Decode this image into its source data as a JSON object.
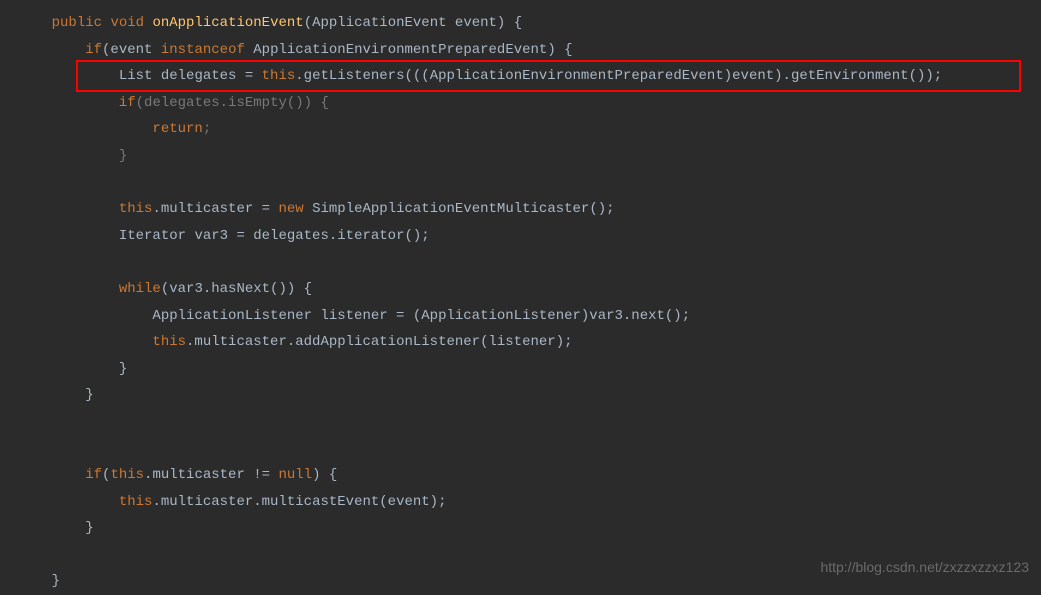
{
  "code": {
    "line1_public": "public",
    "line1_void": "void",
    "line1_method": "onApplicationEvent",
    "line1_rest": "(ApplicationEvent event) {",
    "line2_if": "if",
    "line2_event": "(event",
    "line2_instanceof": "instanceof",
    "line2_rest": "ApplicationEnvironmentPreparedEvent) {",
    "line3_list": "List delegates = ",
    "line3_this": "this",
    "line3_rest": ".getListeners(((ApplicationEnvironmentPreparedEvent)event).getEnvironment());",
    "line4_if": "if",
    "line4_rest": "(delegates.isEmpty()) {",
    "line5_return": "return",
    "line5_semi": ";",
    "line6_brace": "}",
    "line7_this": "this",
    "line7_mult": ".multicaster = ",
    "line7_new": "new",
    "line7_rest": " SimpleApplicationEventMulticaster();",
    "line8_iter": "Iterator var3 = delegates.iterator();",
    "line9_while": "while",
    "line9_rest": "(var3.hasNext()) {",
    "line10_text": "ApplicationListener listener = (ApplicationListener)var3.next();",
    "line11_this": "this",
    "line11_rest": ".multicaster.addApplicationListener(listener);",
    "line12_brace": "}",
    "line13_brace": "}",
    "line14_if": "if",
    "line14_open": "(",
    "line14_this": "this",
    "line14_mid": ".multicaster != ",
    "line14_null": "null",
    "line14_rest": ") {",
    "line15_this": "this",
    "line15_rest": ".multicaster.multicastEvent(event);",
    "line16_brace": "}",
    "line17_brace": "}"
  },
  "watermark": "http://blog.csdn.net/zxzzxzzxz123"
}
